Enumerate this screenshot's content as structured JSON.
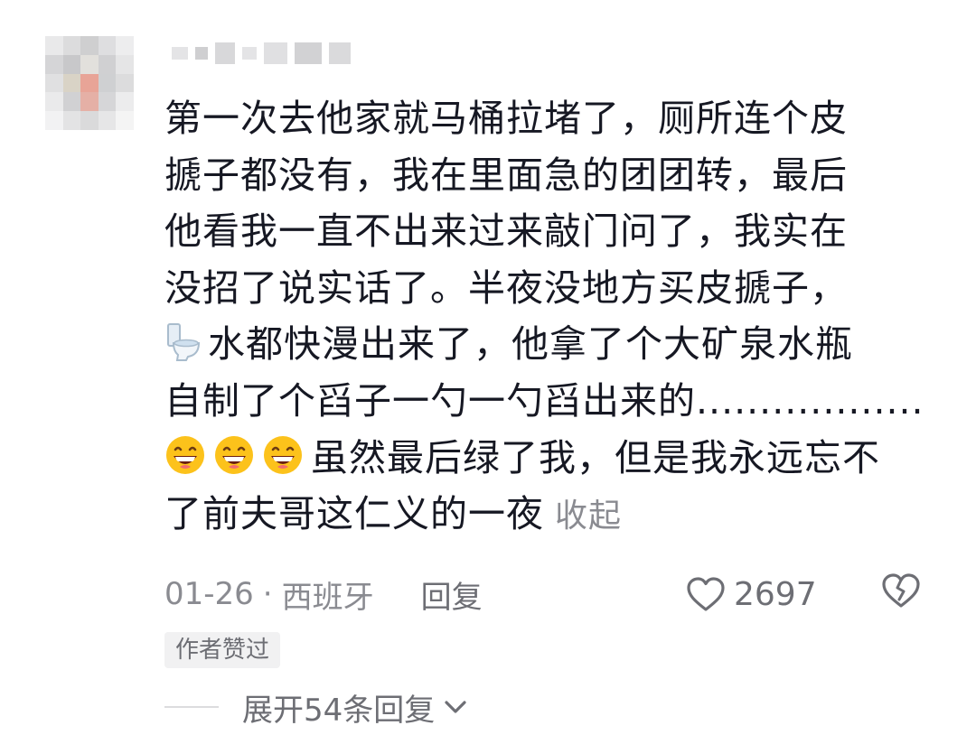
{
  "comment": {
    "lines": [
      "第一次去他家就马桶拉堵了，厕所连个皮",
      "搋子都没有，我在里面急的团团转，最后",
      "他看我一直不出来过来敲门问了，我实在",
      "没招了说实话了。半夜没地方买皮搋子，",
      "水都快漫出来了，他拿了个大矿泉水瓶",
      "自制了个舀子一勺一勺舀出来的..................",
      "虽然最后绿了我，但是我永远忘不",
      "了前夫哥这仁义的一夜"
    ],
    "collapse_label": "收起",
    "emojis": [
      "toilet-emoji",
      "grinning-face-emoji",
      "grinning-face-emoji",
      "grinning-face-emoji"
    ]
  },
  "meta": {
    "date": "01-26",
    "separator": "·",
    "location": "西班牙",
    "reply_label": "回复",
    "like_count": "2697"
  },
  "author_liked_tag": "作者赞过",
  "expand_replies_label": "展开54条回复",
  "colors": {
    "text": "#161823",
    "secondary": "#8a8b91",
    "tag_bg": "#f1f1f2"
  }
}
